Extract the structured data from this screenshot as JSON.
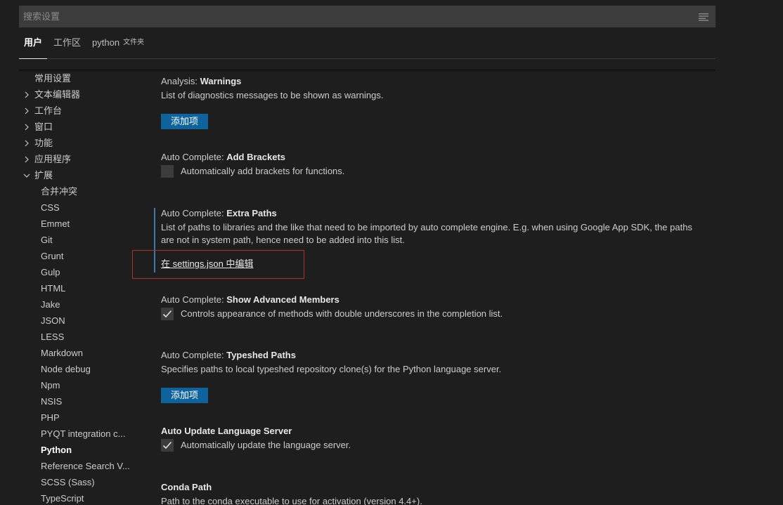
{
  "search": {
    "placeholder": "搜索设置"
  },
  "tabs": [
    {
      "label": "用户"
    },
    {
      "label": "工作区"
    },
    {
      "label": "python",
      "sub": "文件夹"
    }
  ],
  "tree": [
    {
      "label": "常用设置"
    },
    {
      "label": "文本编辑器"
    },
    {
      "label": "工作台"
    },
    {
      "label": "窗口"
    },
    {
      "label": "功能"
    },
    {
      "label": "应用程序"
    },
    {
      "label": "扩展"
    },
    {
      "label": "合并冲突"
    },
    {
      "label": "CSS"
    },
    {
      "label": "Emmet"
    },
    {
      "label": "Git"
    },
    {
      "label": "Grunt"
    },
    {
      "label": "Gulp"
    },
    {
      "label": "HTML"
    },
    {
      "label": "Jake"
    },
    {
      "label": "JSON"
    },
    {
      "label": "LESS"
    },
    {
      "label": "Markdown"
    },
    {
      "label": "Node debug"
    },
    {
      "label": "Npm"
    },
    {
      "label": "NSIS"
    },
    {
      "label": "PHP"
    },
    {
      "label": "PYQT integration c..."
    },
    {
      "label": "Python"
    },
    {
      "label": "Reference Search V..."
    },
    {
      "label": "SCSS (Sass)"
    },
    {
      "label": "TypeScript"
    }
  ],
  "settings": {
    "warnings": {
      "category": "Analysis: ",
      "name": "Warnings",
      "desc": "List of diagnostics messages to be shown as warnings.",
      "button": "添加项"
    },
    "add_brackets": {
      "category": "Auto Complete: ",
      "name": "Add Brackets",
      "desc": "Automatically add brackets for functions.",
      "checked": false
    },
    "extra_paths": {
      "category": "Auto Complete: ",
      "name": "Extra Paths",
      "desc1": "List of paths to libraries and the like that need to be imported by auto complete engine. E.g. when using Google App SDK, the paths",
      "desc2": "are not in system path, hence need to be added into this list.",
      "link": "在 settings.json 中编辑"
    },
    "advanced_members": {
      "category": "Auto Complete: ",
      "name": "Show Advanced Members",
      "desc": "Controls appearance of methods with double underscores in the completion list.",
      "checked": true
    },
    "typeshed_paths": {
      "category": "Auto Complete: ",
      "name": "Typeshed Paths",
      "desc": "Specifies paths to local typeshed repository clone(s) for the Python language server.",
      "button": "添加项"
    },
    "auto_update": {
      "name": "Auto Update Language Server",
      "desc": "Automatically update the language server.",
      "checked": true
    },
    "conda_path": {
      "name": "Conda Path",
      "desc": "Path to the conda executable to use for activation (version 4.4+)."
    }
  },
  "colors": {
    "accent_button": "#0e639c",
    "focus_bar": "#3d7aa6",
    "highlight_box": "#b2302a"
  }
}
